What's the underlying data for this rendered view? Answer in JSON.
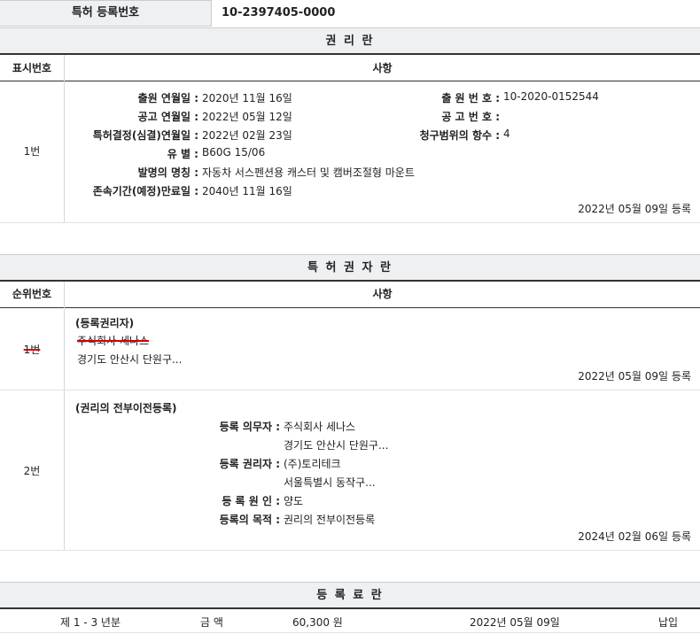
{
  "top": {
    "label": "특허 등록번호",
    "value": "10-2397405-0000"
  },
  "rights": {
    "title": "권 리 란",
    "col_num": "표시번호",
    "col_item": "사항",
    "row": {
      "num": "1번",
      "fields": [
        {
          "label": "출원 연월일 :",
          "value": "2020년 11월 16일"
        },
        {
          "label": "공고 연월일 :",
          "value": "2022년 05월 12일"
        },
        {
          "label": "특허결정(심결)연월일 :",
          "value": "2022년 02월 23일"
        },
        {
          "label": "유 별 :",
          "value": "B60G 15/06"
        },
        {
          "label": "발명의 명칭 :",
          "value": "자동차 서스펜션용 캐스터 및 캠버조절형 마운트"
        },
        {
          "label": "존속기간(예정)만료일 :",
          "value": "2040년 11월 16일"
        }
      ],
      "right_fields": [
        {
          "label": "출 원 번 호 :",
          "value": "10-2020-0152544"
        },
        {
          "label": "공 고 번 호 :",
          "value": ""
        },
        {
          "label": "청구범위의 항수 :",
          "value": "4"
        }
      ],
      "reg_date": "2022년 05월 09일 등록"
    }
  },
  "holders": {
    "title": "특 허 권 자 란",
    "col_num": "순위번호",
    "col_item": "사항",
    "row1": {
      "num": "1번",
      "heading": "(등록권리자)",
      "name": "주식회사 세나스",
      "address": "경기도 안산시 단원구...",
      "reg_date": "2022년 05월 09일 등록"
    },
    "row2": {
      "num": "2번",
      "heading": "(권리의 전부이전등록)",
      "obligor_label": "등록 의무자 :",
      "obligor_name": "주식회사 세나스",
      "obligor_addr": "경기도 안산시 단원구...",
      "holder_label": "등록 권리자 :",
      "holder_name": "(주)토리테크",
      "holder_addr": "서울특별시 동작구...",
      "cause_label": "등 록 원 인 :",
      "cause_value": "양도",
      "purpose_label": "등록의 목적 :",
      "purpose_value": "권리의 전부이전등록",
      "reg_date": "2024년 02월 06일 등록"
    }
  },
  "fees": {
    "title": "등 록 료 란",
    "period": "제 1 - 3 년분",
    "amount_label": "금 액",
    "amount": "60,300 원",
    "date": "2022년 05월 09일",
    "status": "납입"
  }
}
